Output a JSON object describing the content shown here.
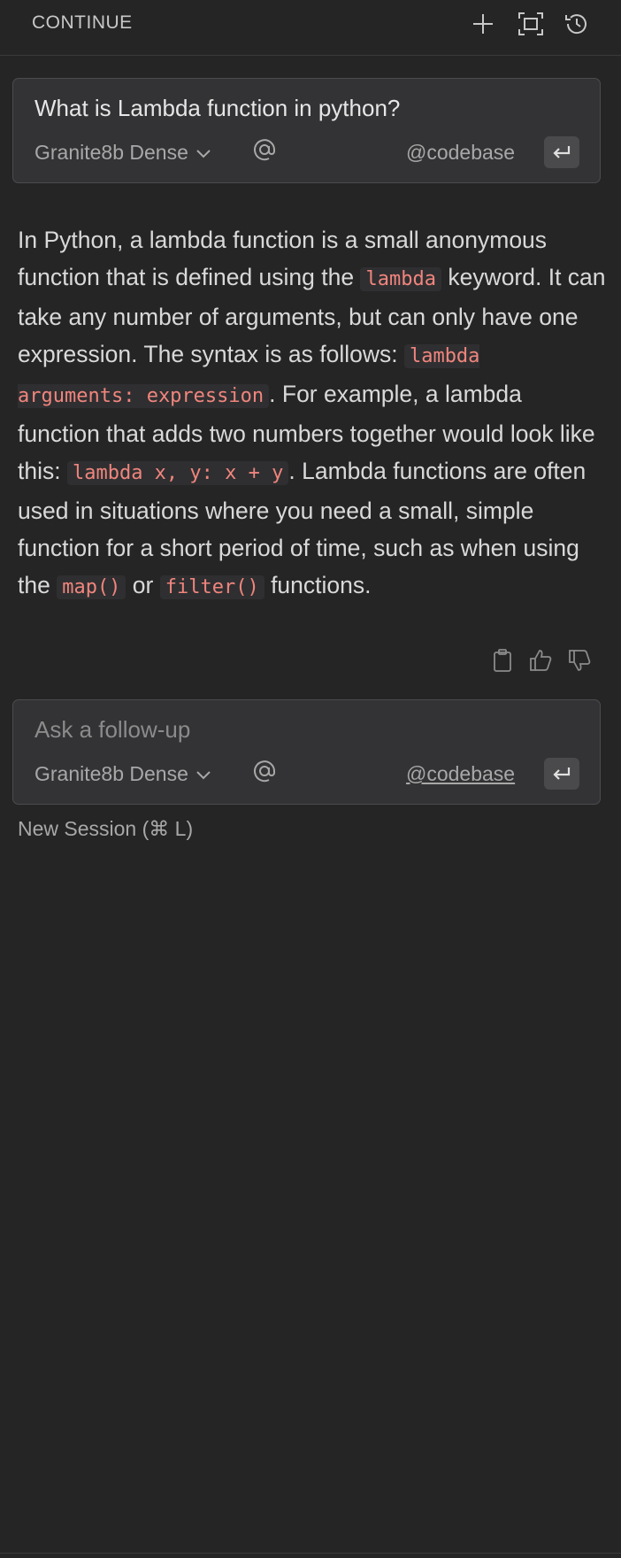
{
  "header": {
    "title": "CONTINUE",
    "icons": [
      "plus-icon",
      "fullscreen-icon",
      "history-icon"
    ]
  },
  "first_input": {
    "text": "What is Lambda function in python?",
    "model": "Granite8b Dense",
    "at_symbol": "@",
    "codebase_label": "@codebase"
  },
  "response": {
    "p1": "In Python, a lambda function is a small anonymous function that is defined using the ",
    "c1": "lambda",
    "p2": " keyword. It can take any number of arguments, but can only have one expression. The syntax is as follows: ",
    "c2": "lambda arguments: expression",
    "p3": ". For example, a lambda function that adds two numbers together would look like this: ",
    "c3": "lambda x, y: x + y",
    "p4": ". Lambda functions are often used in situations where you need a small, simple function for a short period of time, such as when using the ",
    "c4": "map()",
    "p5": " or ",
    "c5": "filter()",
    "p6": " functions."
  },
  "response_actions": [
    "copy-icon",
    "thumbs-up-icon",
    "thumbs-down-icon"
  ],
  "followup_input": {
    "placeholder": "Ask a follow-up",
    "model": "Granite8b Dense",
    "at_symbol": "@",
    "codebase_label": "@codebase"
  },
  "footer": {
    "new_session": "New Session (⌘ L)"
  },
  "colors": {
    "background": "#252526",
    "input_bg": "#333335",
    "code_text": "#f0857d"
  }
}
